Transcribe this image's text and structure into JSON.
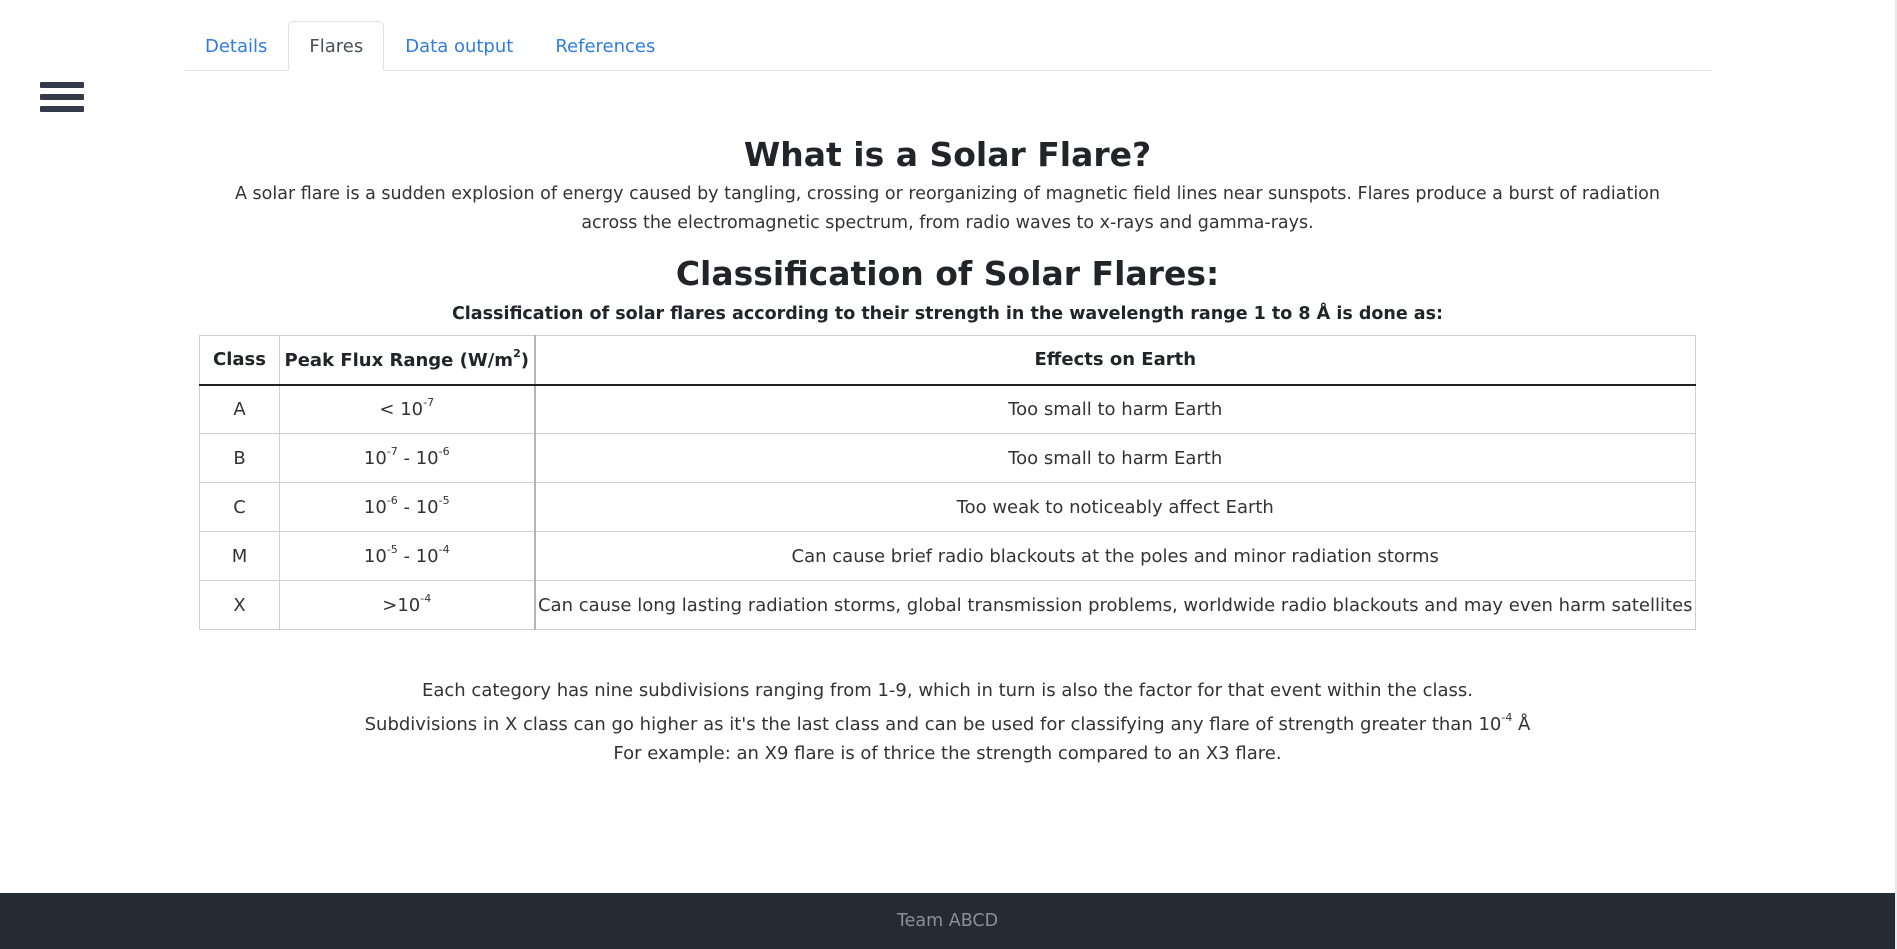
{
  "tabs": [
    {
      "label": "Details",
      "active": false
    },
    {
      "label": "Flares",
      "active": true
    },
    {
      "label": "Data output",
      "active": false
    },
    {
      "label": "References",
      "active": false
    }
  ],
  "menu_icon": "hamburger-menu-icon",
  "main": {
    "title": "What is a Solar Flare?",
    "intro": "A solar flare is a sudden explosion of energy caused by tangling, crossing or reorganizing of magnetic field lines near sunspots. Flares produce a burst of radiation across the electromagnetic spectrum, from radio waves to x-rays and gamma-rays.",
    "classification_title": "Classification of Solar Flares:",
    "classification_subtitle": "Classification of solar flares according to their strength in the wavelength range 1 to 8 Å is done as:",
    "table": {
      "headers": {
        "class": "Class",
        "flux": "Peak Flux Range (W/m",
        "flux_sup": "2",
        "flux_end": ")",
        "effects": "Effects on Earth"
      },
      "rows": [
        {
          "cls": "A",
          "f1": "< 10",
          "f1s": "-7",
          "f2": "",
          "f2s": "",
          "effect": "Too small to harm Earth"
        },
        {
          "cls": "B",
          "f1": "10",
          "f1s": "-7",
          "f2": " - 10",
          "f2s": "-6",
          "effect": "Too small to harm Earth"
        },
        {
          "cls": "C",
          "f1": "10",
          "f1s": "-6",
          "f2": " - 10",
          "f2s": "-5",
          "effect": "Too weak to noticeably affect Earth"
        },
        {
          "cls": "M",
          "f1": "10",
          "f1s": "-5",
          "f2": " - 10",
          "f2s": "-4",
          "effect": "Can cause brief radio blackouts at the poles and minor radiation storms"
        },
        {
          "cls": "X",
          "f1": ">10",
          "f1s": "-4",
          "f2": "",
          "f2s": "",
          "effect": "Can cause long lasting radiation storms, global transmission problems, worldwide radio blackouts and may even harm satellites"
        }
      ]
    },
    "notes": {
      "line1": "Each category has nine subdivisions ranging from 1-9, which in turn is also the factor for that event within the class.",
      "line2": "Subdivisions in X class can go higher as it's the last class and can be used for classifying any flare of strength greater than 10",
      "line2_sup": "-4",
      "line2_end": " Å",
      "line3": "For example: an X9 flare is of thrice the strength compared to an X3 flare."
    }
  },
  "footer": {
    "text": "Team ABCD"
  }
}
